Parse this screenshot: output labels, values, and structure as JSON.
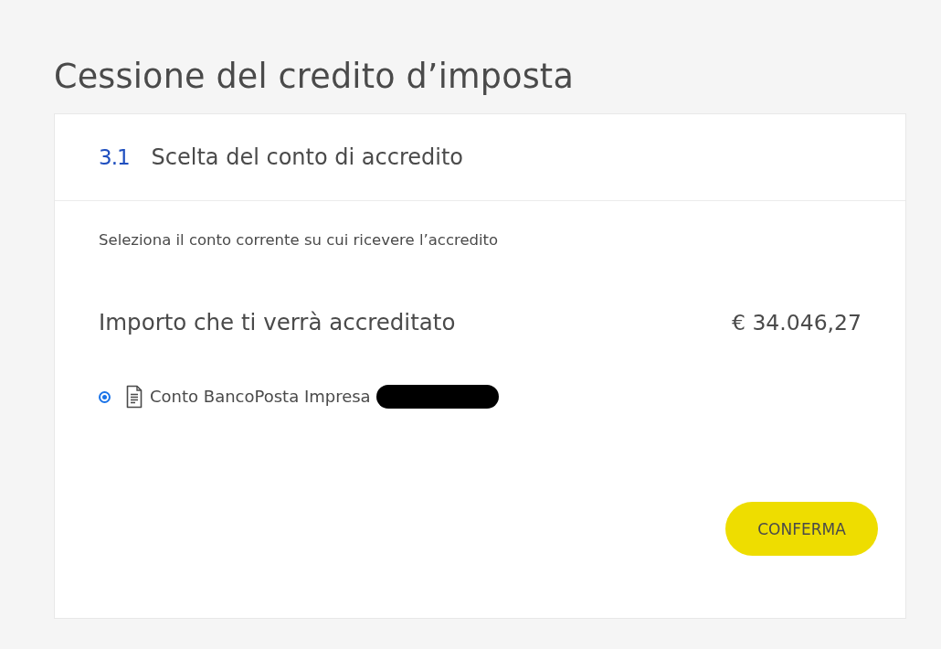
{
  "page": {
    "title": "Cessione del credito d’imposta"
  },
  "section": {
    "number": "3.1",
    "title": "Scelta del conto di accredito"
  },
  "instruction": "Seleziona il conto corrente su cui ricevere l’accredito",
  "amount": {
    "label": "Importo che ti verrà accreditato",
    "value": "€ 34.046,27"
  },
  "accounts": [
    {
      "name": "Conto BancoPosta Impresa",
      "selected": true,
      "redacted": true
    }
  ],
  "buttons": [
    {
      "label": "CONFERMA"
    }
  ]
}
